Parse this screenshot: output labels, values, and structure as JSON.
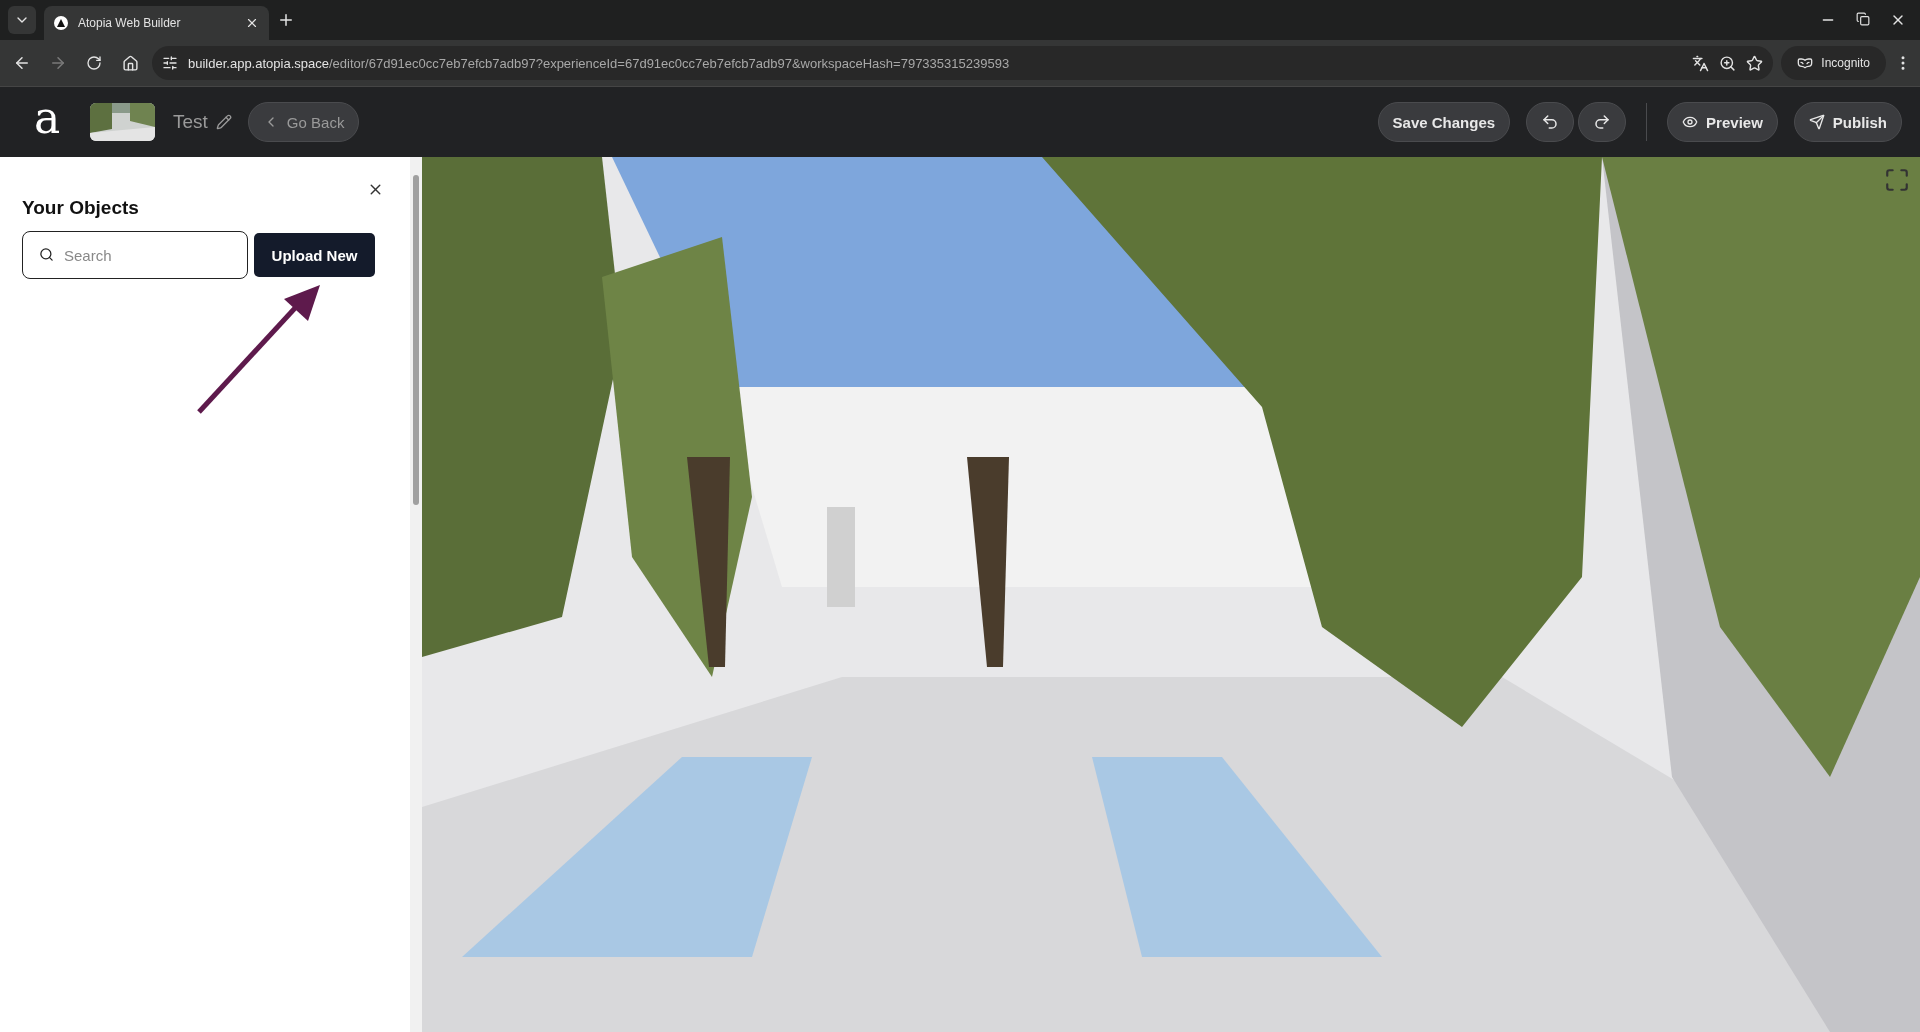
{
  "browser": {
    "tab": {
      "title": "Atopia Web Builder"
    },
    "url_host": "builder.app.atopia.space",
    "url_path": "/editor/67d91ec0cc7eb7efcb7adb97?experienceId=67d91ec0cc7eb7efcb7adb97&workspaceHash=797335315239593",
    "profile": "Incognito"
  },
  "header": {
    "logo": "a",
    "project_name": "Test",
    "back_button": "Go Back",
    "save_button": "Save Changes",
    "preview_button": "Preview",
    "publish_button": "Publish"
  },
  "panel": {
    "title": "Your Objects",
    "search": {
      "placeholder": "Search"
    },
    "upload_button": "Upload New"
  }
}
